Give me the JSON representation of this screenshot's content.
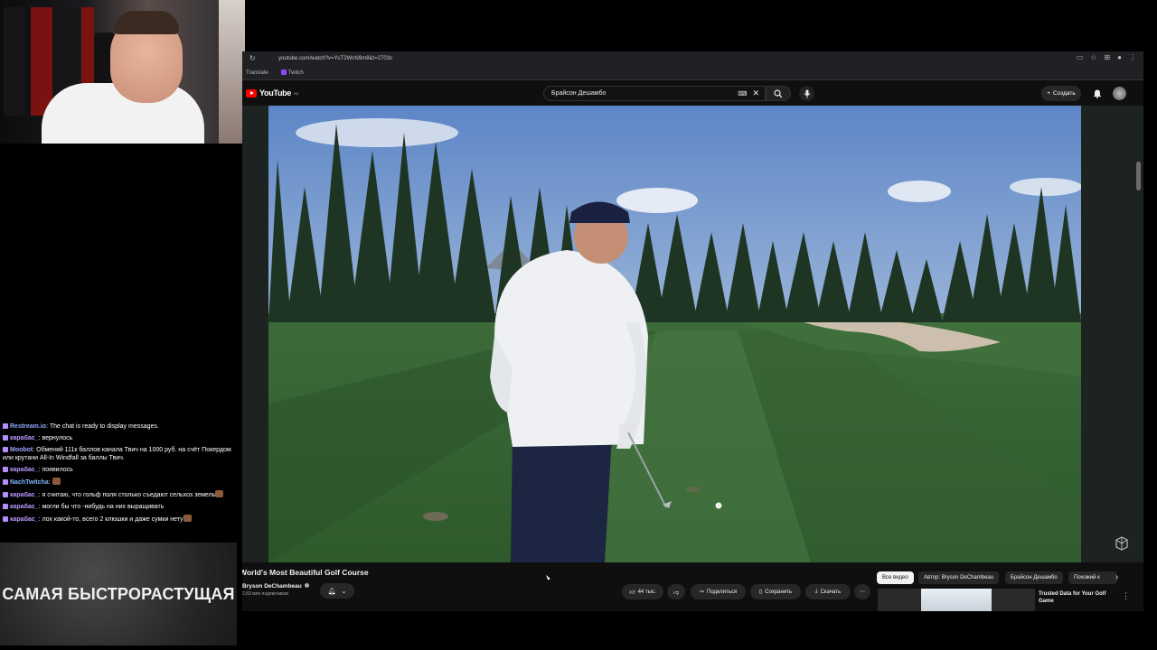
{
  "browser": {
    "url": "youtube.com/watch?v=YuT2WnN9m8&t=2703s",
    "bookmarks": [
      "Translate",
      "Twitch"
    ]
  },
  "youtube": {
    "logo": "YouTube",
    "logo_sup": "RU",
    "search_value": "Брайсон Дешамбо",
    "create_label": "Создать"
  },
  "video": {
    "title": "World's Most Beautiful Golf Course",
    "channel_name": "Bryson DeChambeau",
    "subscribers": "2,83 млн подписчиков",
    "likes": "44 тыс.",
    "share_label": "Поделиться",
    "save_label": "Сохранить",
    "download_label": "Скачать"
  },
  "filters": [
    {
      "label": "Все видео",
      "active": true
    },
    {
      "label": "Автор: Bryson DeChambeau",
      "active": false
    },
    {
      "label": "Брайсон Дешамбо",
      "active": false
    },
    {
      "label": "Похожий к",
      "active": false
    }
  ],
  "recommendation": {
    "title": "Trusted Data for Your Golf Game"
  },
  "chat": [
    {
      "user": "Restream.io",
      "text": "The chat is ready to display messages.",
      "cls": "u-restream"
    },
    {
      "user": "карабас_",
      "text": "вернулось",
      "cls": "u-kar"
    },
    {
      "user": "Moobot",
      "text": "Обменяй 111к баллов канала Твич на 1000 руб. на счёт Покердом или крутани All-In Windfall за баллы Твич.",
      "cls": "u-moobot"
    },
    {
      "user": "карабас_",
      "text": "появилось",
      "cls": "u-kar"
    },
    {
      "user": "NachTwitcha",
      "text": "",
      "cls": "u-nach"
    },
    {
      "user": "карабас_",
      "text": "я считаю, что гольф поля столько съедают сельхоз земель",
      "cls": "u-kar"
    },
    {
      "user": "карабас_",
      "text": "могли бы что -нибудь на них выращивать",
      "cls": "u-kar"
    },
    {
      "user": "карабас_",
      "text": "лох какой-то, всего 2 клюшки и даже сумки нету",
      "cls": "u-kar"
    }
  ],
  "banner": {
    "text": "САМАЯ БЫСТРОРАСТУЩАЯ"
  }
}
